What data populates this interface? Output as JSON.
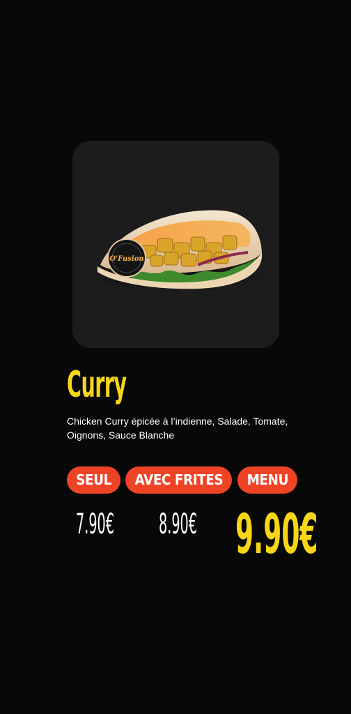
{
  "product": {
    "image_icon": "chicken-curry-wrap-icon",
    "logo_text": "O'Fusion",
    "title": "Curry",
    "description": "Chicken Curry épicée à l’indienne, Salade, Tomate, Oignons, Sauce Blanche"
  },
  "options": [
    {
      "label": "SEUL",
      "price": "7.90€"
    },
    {
      "label": "AVEC FRITES",
      "price": "8.90€"
    },
    {
      "label": "MENU",
      "price": "9.90€"
    }
  ],
  "colors": {
    "background": "#080808",
    "card": "#1c1c1c",
    "accent_yellow": "#f7d617",
    "pill_red": "#ef4326"
  }
}
